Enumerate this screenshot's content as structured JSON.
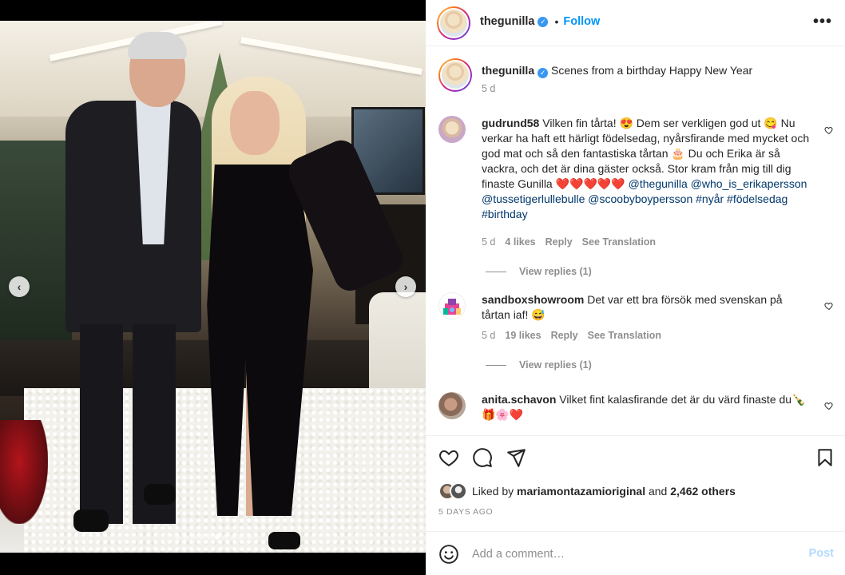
{
  "post": {
    "author": "thegunilla",
    "follow_label": "Follow",
    "bullet": "•",
    "more": "•••",
    "caption_text": "Scenes from a birthday Happy New Year",
    "caption_time": "5 d"
  },
  "media": {
    "slide_count": 10,
    "active_slide": 5
  },
  "comments": [
    {
      "user": "gudrund58",
      "text_1": "Vilken fin tårta! 😍 Dem ser verkligen god ut 😋 Nu verkar ha haft ett härligt födelsedag, nyårsfirande med mycket och god mat och så den fantastiska tårtan 🎂 Du och Erika är så vackra, och det är dina gäster också. Stor kram från mig till dig finaste Gunilla ❤️❤️❤️❤️❤️ ",
      "tags": "@thegunilla @who_is_erikapersson @tussetigerlullebulle @scoobyboypersson #nyår #födelsedag #birthday",
      "time": "5 d",
      "likes": "4 likes",
      "reply": "Reply",
      "translate": "See Translation",
      "view_replies": "View replies (1)"
    },
    {
      "user": "sandboxshowroom",
      "text_1": "Det var ett bra försök med svenskan på tårtan iaf! 😅",
      "time": "5 d",
      "likes": "19 likes",
      "reply": "Reply",
      "translate": "See Translation",
      "view_replies": "View replies (1)"
    },
    {
      "user": "anita.schavon",
      "text_1": "Vilket fint kalasfirande det är du värd finaste du🍾🎁🌸❤️"
    }
  ],
  "likes": {
    "prefix": "Liked by",
    "user": "mariamontazamioriginal",
    "and": "and",
    "others": "2,462 others",
    "date": "5 DAYS AGO"
  },
  "add_comment": {
    "placeholder": "Add a comment…",
    "post_label": "Post"
  },
  "colors": {
    "link_blue": "#0095f6",
    "tag_blue": "#00376b",
    "muted": "#8e8e8e",
    "post_disabled": "#b3dbff"
  }
}
